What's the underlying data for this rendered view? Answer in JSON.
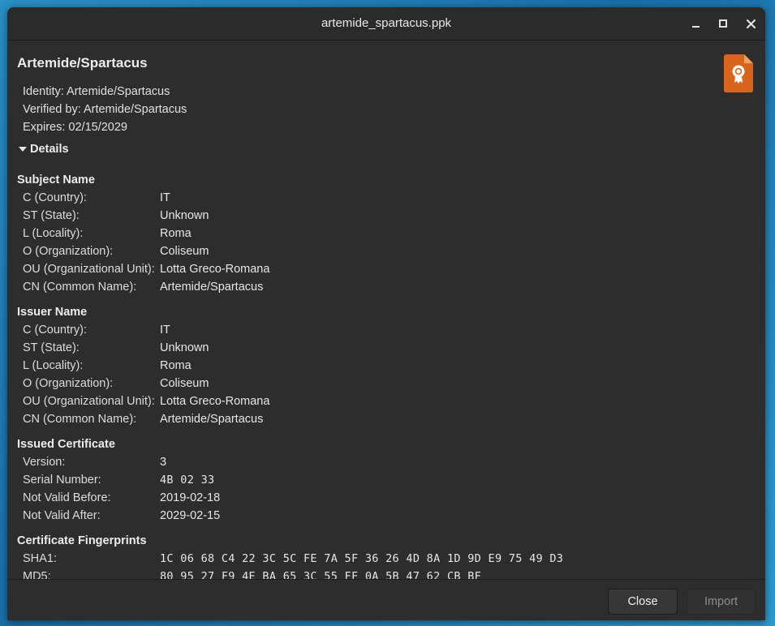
{
  "window": {
    "title": "artemide_spartacus.ppk"
  },
  "certificate": {
    "name": "Artemide/Spartacus",
    "identity": "Identity: Artemide/Spartacus",
    "verified_by": "Verified by: Artemide/Spartacus",
    "expires": "Expires: 02/15/2029",
    "icon": "certificate-file-icon",
    "icon_color": "#d9651d"
  },
  "details": {
    "toggle_label": "Details",
    "subject": {
      "title": "Subject Name",
      "rows": [
        {
          "key": "C (Country):",
          "value": "IT"
        },
        {
          "key": "ST (State):",
          "value": "Unknown"
        },
        {
          "key": "L (Locality):",
          "value": "Roma"
        },
        {
          "key": "O (Organization):",
          "value": "Coliseum"
        },
        {
          "key": "OU (Organizational Unit):",
          "value": "Lotta Greco-Romana"
        },
        {
          "key": "CN (Common Name):",
          "value": "Artemide/Spartacus"
        }
      ]
    },
    "issuer": {
      "title": "Issuer Name",
      "rows": [
        {
          "key": "C (Country):",
          "value": "IT"
        },
        {
          "key": "ST (State):",
          "value": "Unknown"
        },
        {
          "key": "L (Locality):",
          "value": "Roma"
        },
        {
          "key": "O (Organization):",
          "value": "Coliseum"
        },
        {
          "key": "OU (Organizational Unit):",
          "value": "Lotta Greco-Romana"
        },
        {
          "key": "CN (Common Name):",
          "value": "Artemide/Spartacus"
        }
      ]
    },
    "issued": {
      "title": "Issued Certificate",
      "rows": [
        {
          "key": "Version:",
          "value": "3"
        },
        {
          "key": "Serial Number:",
          "value": "4B 02 33"
        },
        {
          "key": "Not Valid Before:",
          "value": "2019-02-18"
        },
        {
          "key": "Not Valid After:",
          "value": "2029-02-15"
        }
      ]
    },
    "fingerprints": {
      "title": "Certificate Fingerprints",
      "rows": [
        {
          "key": "SHA1:",
          "value": "1C 06 68 C4 22 3C 5C FE 7A 5F 36 26 4D 8A 1D 9D E9 75 49 D3"
        },
        {
          "key": "MD5:",
          "value": "80 95 27 F9 4E BA 65 3C 55 FF 0A 5B 47 62 CB BF"
        }
      ]
    }
  },
  "footer": {
    "close_label": "Close",
    "import_label": "Import"
  }
}
